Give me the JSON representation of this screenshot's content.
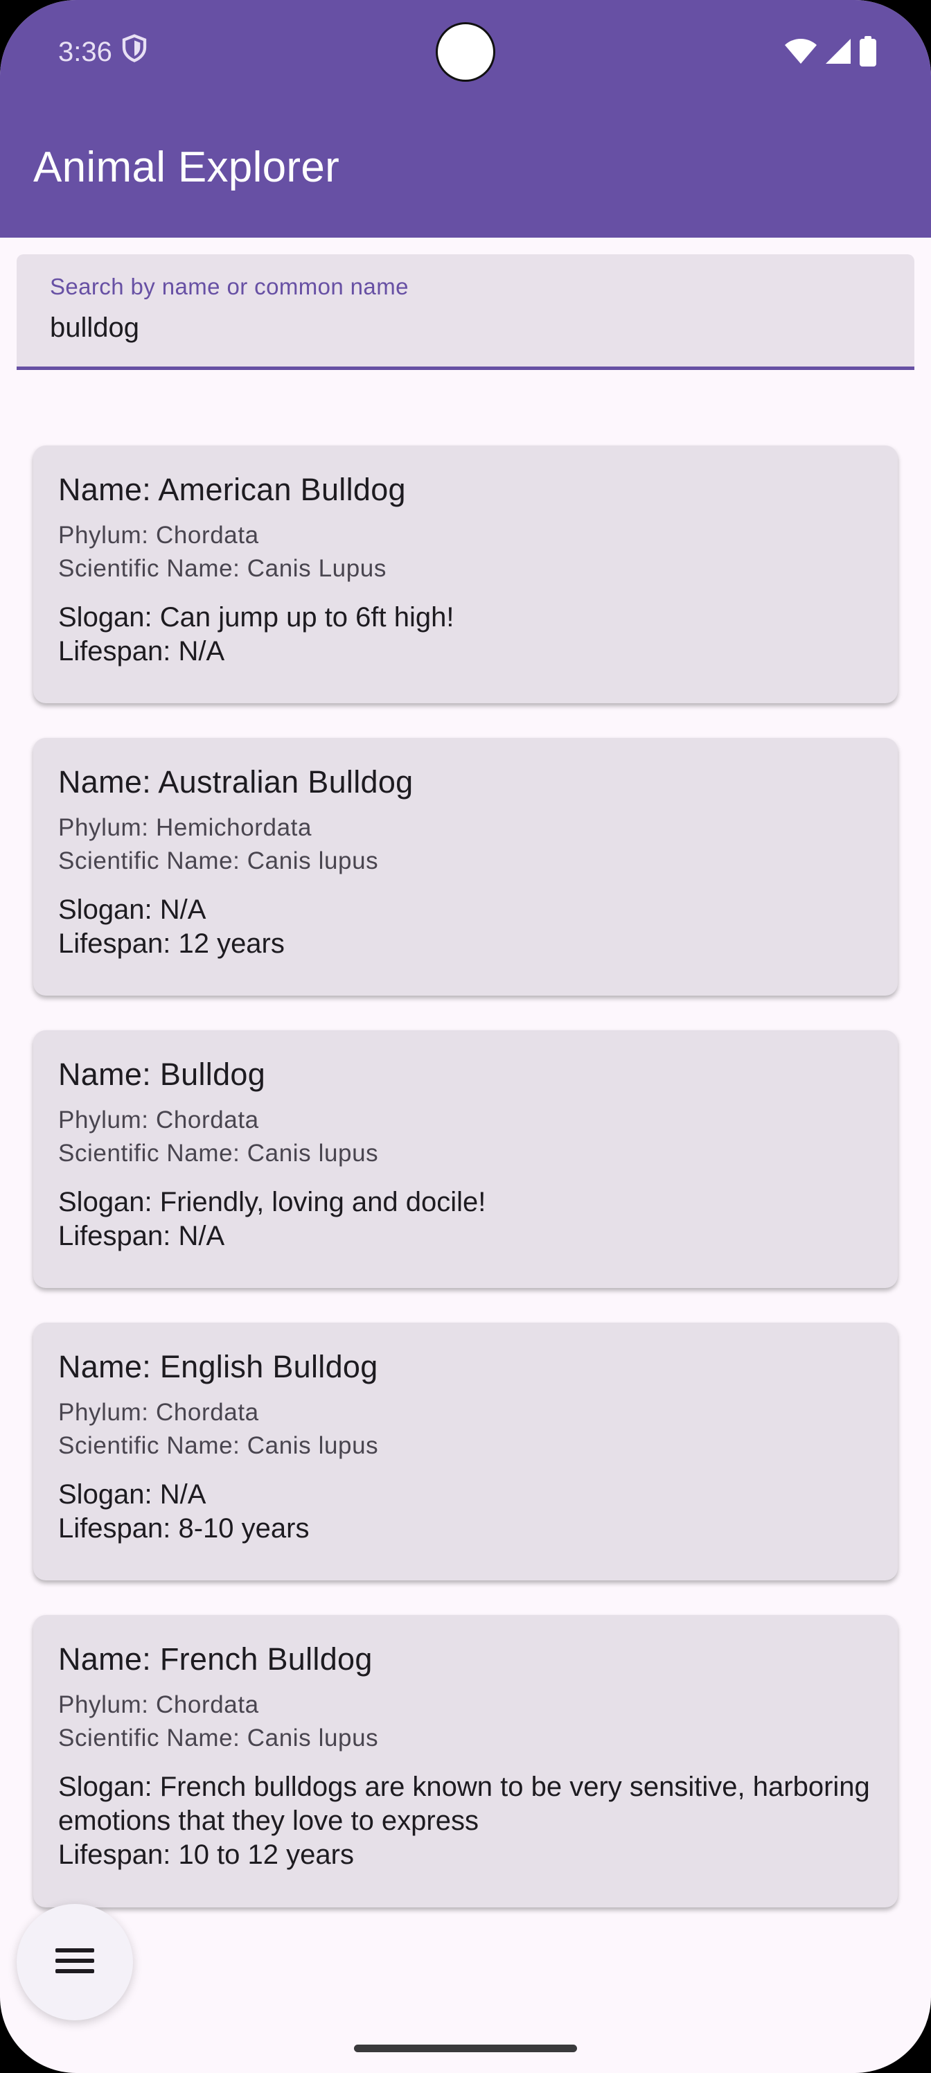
{
  "status_bar": {
    "time": "3:36"
  },
  "app_bar": {
    "title": "Animal Explorer",
    "color": "#6750a4"
  },
  "search": {
    "label": "Search by name or common name",
    "value": "bulldog"
  },
  "results": [
    {
      "name": "Name: American Bulldog",
      "phylum": "Phylum: Chordata",
      "scientific": "Scientific Name: Canis Lupus",
      "slogan": "Slogan: Can jump up to 6ft high!",
      "lifespan": "Lifespan: N/A"
    },
    {
      "name": "Name: Australian Bulldog",
      "phylum": "Phylum: Hemichordata",
      "scientific": "Scientific Name: Canis lupus",
      "slogan": "Slogan: N/A",
      "lifespan": "Lifespan: 12 years"
    },
    {
      "name": "Name: Bulldog",
      "phylum": "Phylum: Chordata",
      "scientific": "Scientific Name: Canis lupus",
      "slogan": "Slogan: Friendly, loving and docile!",
      "lifespan": "Lifespan: N/A"
    },
    {
      "name": "Name: English Bulldog",
      "phylum": "Phylum: Chordata",
      "scientific": "Scientific Name: Canis lupus",
      "slogan": "Slogan: N/A",
      "lifespan": "Lifespan: 8-10 years"
    },
    {
      "name": "Name: French Bulldog",
      "phylum": "Phylum: Chordata",
      "scientific": "Scientific Name: Canis lupus",
      "slogan": "Slogan:  French bulldogs are known to be very sensitive, harboring emotions that they love to express",
      "lifespan": "Lifespan: 10 to 12 years"
    }
  ],
  "fab": {
    "icon": "menu-icon"
  }
}
